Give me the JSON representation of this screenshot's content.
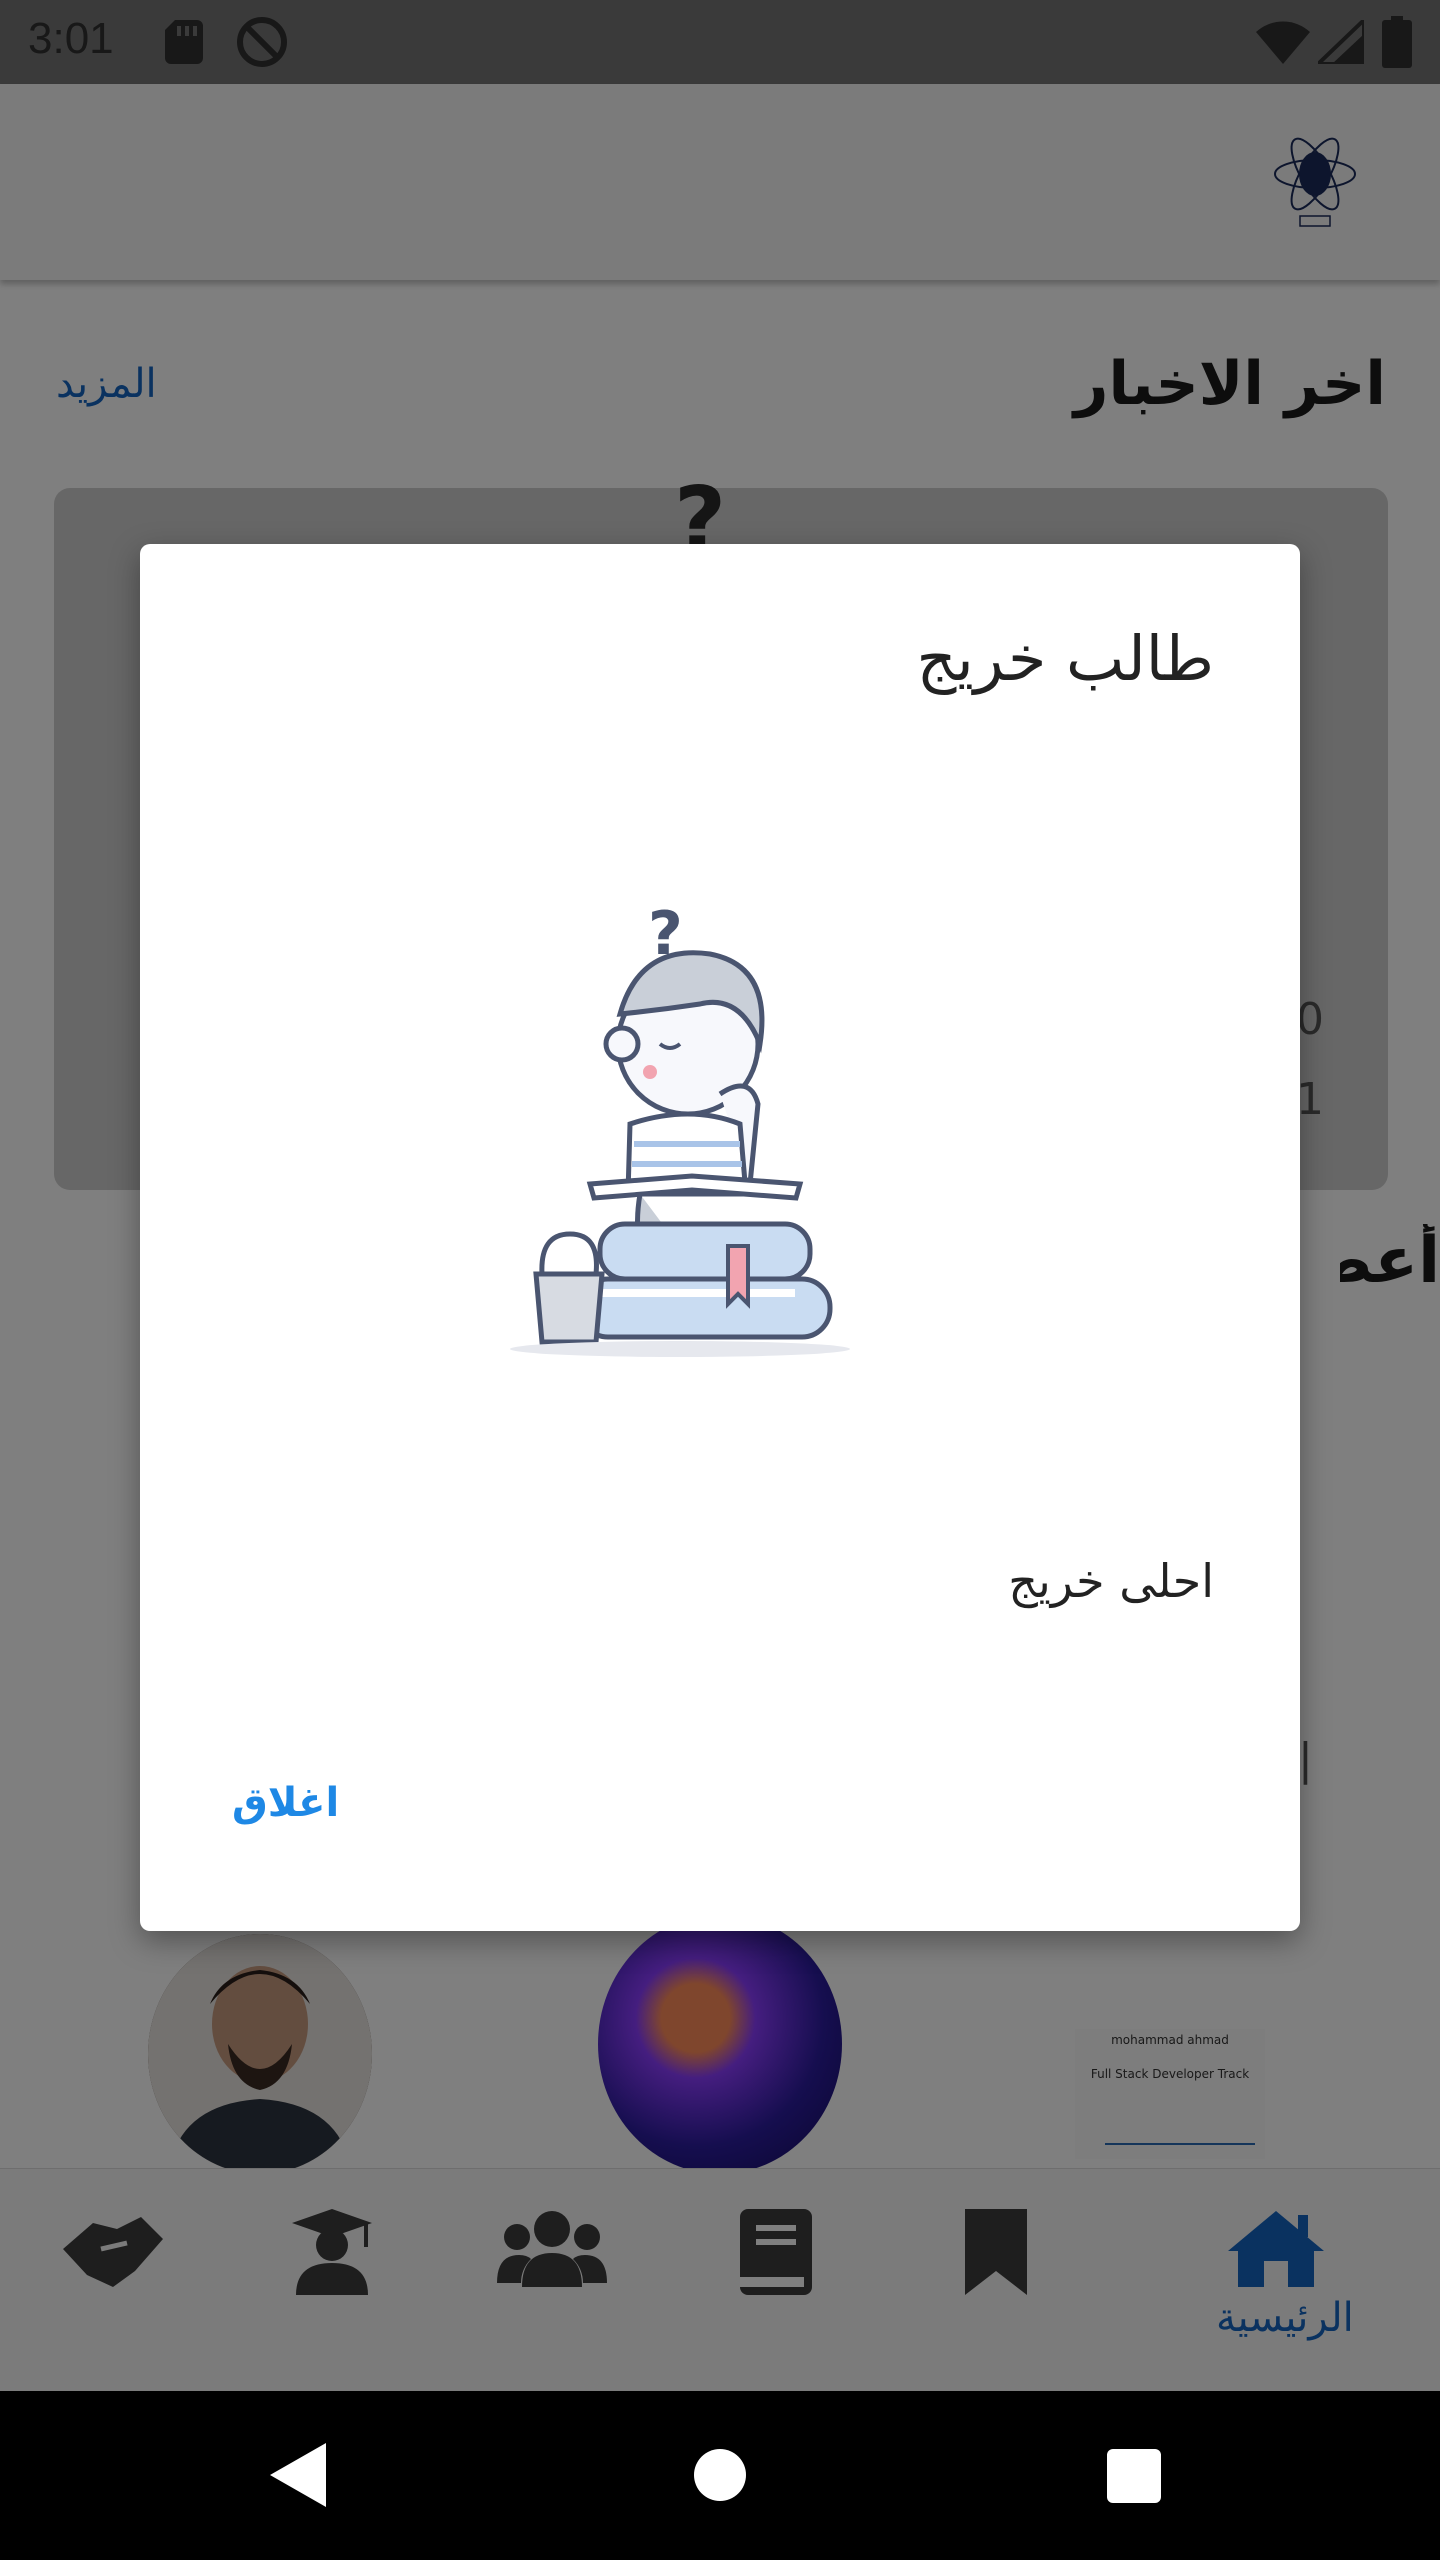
{
  "status_bar": {
    "time": "3:01",
    "icons": [
      "sd-card-icon",
      "do-not-disturb-icon",
      "wifi-icon",
      "cell-signal-icon",
      "battery-icon"
    ]
  },
  "app_bar": {
    "logo_icon": "atom-logo-icon"
  },
  "news_section": {
    "title": "اخر الاخبار",
    "more_label": "المزيد"
  },
  "members_section": {
    "title_partial": "أعض"
  },
  "bottom_nav": {
    "items": [
      {
        "icon": "home-icon",
        "label": "الرئيسية",
        "active": true
      },
      {
        "icon": "bookmark-icon"
      },
      {
        "icon": "book-icon"
      },
      {
        "icon": "people-icon"
      },
      {
        "icon": "graduate-icon"
      },
      {
        "icon": "handshake-icon"
      }
    ],
    "active_color": "#1565c0"
  },
  "dialog": {
    "title": "طالب خريج",
    "illustration": "student-reading-on-books-illustration",
    "message": "احلى خريج",
    "close_label": "اغلاق",
    "accent_color": "#1e88e5"
  },
  "certificate": {
    "name": "mohammad ahmad",
    "track": "Full Stack Developer Track"
  },
  "system_nav": {
    "icons": [
      "back-icon",
      "home-circle-icon",
      "recents-icon"
    ]
  }
}
